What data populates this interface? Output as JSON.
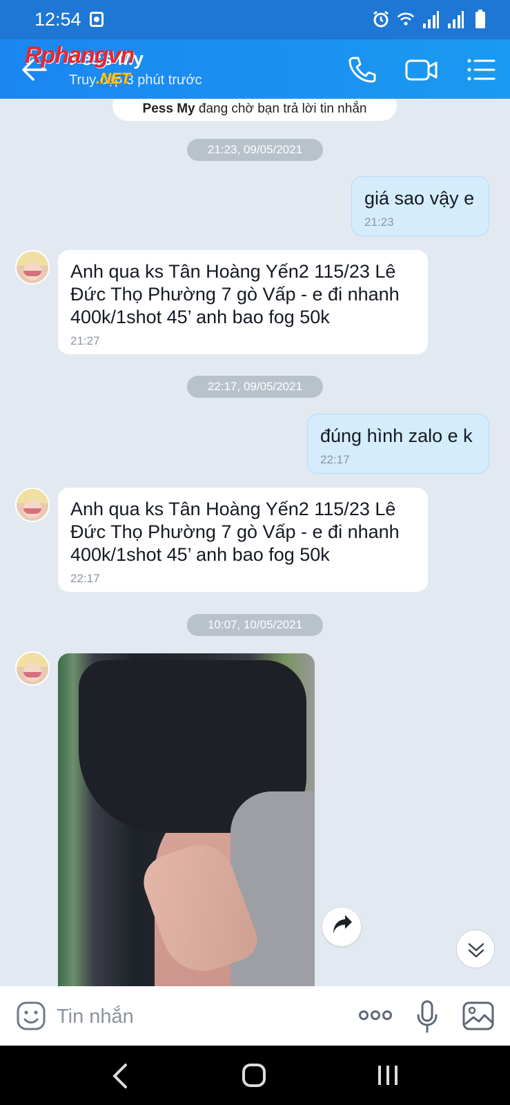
{
  "status_bar": {
    "time": "12:54",
    "icons": [
      "photo-icon",
      "alarm-icon",
      "wifi-icon",
      "signal-icon",
      "signal-icon-2",
      "battery-icon"
    ]
  },
  "header": {
    "contact_name": "Pess My",
    "contact_status": "Truy cập 3 phút trước",
    "watermark_logo": "Rphangvn",
    "watermark_sub": ".NET",
    "icons": [
      "back-arrow-icon",
      "phone-icon",
      "video-call-icon",
      "menu-list-icon"
    ]
  },
  "chat": {
    "pending_notice_name": "Pess My",
    "pending_notice_text": " đang chờ bạn trả lời tin nhắn",
    "date_1": "21:23, 09/05/2021",
    "out_1": {
      "text": "giá sao vậy e",
      "time": "21:23"
    },
    "in_1": {
      "text": "Anh qua ks Tân Hoàng Yến2 115/23 Lê Đức Thọ Phường 7 gò Vấp - e đi nhanh 400k/1shot 45’ anh bao fog 50k",
      "time": "21:27"
    },
    "date_2": "22:17, 09/05/2021",
    "out_2": {
      "text": "đúng hình zalo e k",
      "time": "22:17"
    },
    "in_2": {
      "text": "Anh qua ks Tân Hoàng Yến2 115/23 Lê Đức Thọ Phường 7 gò Vấp - e đi nhanh 400k/1shot 45’ anh bao fog 50k",
      "time": "22:17"
    },
    "date_3": "10:07, 10/05/2021"
  },
  "input_bar": {
    "placeholder": "Tin nhắn",
    "icons": [
      "emoji-icon",
      "more-options-icon",
      "microphone-icon",
      "gallery-icon"
    ]
  },
  "nav_bar": {
    "icons": [
      "nav-back-icon",
      "nav-home-icon",
      "nav-recent-apps-icon"
    ]
  },
  "colors": {
    "header_blue": "#1b86f2",
    "status_blue": "#1e77d4",
    "chat_bg": "#e2e9f1",
    "outgoing_bubble": "#d5ecfd",
    "incoming_bubble": "#ffffff"
  }
}
